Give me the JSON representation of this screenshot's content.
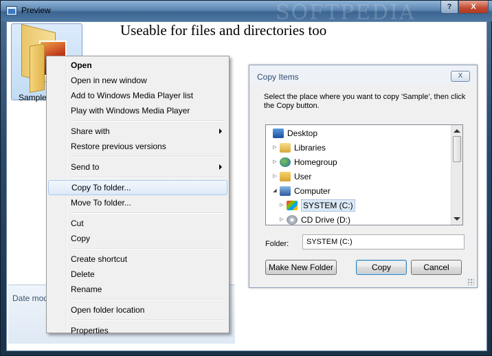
{
  "window": {
    "title": "Preview",
    "watermark": "SOFTPEDIA",
    "help_label": "?",
    "close_label": "X"
  },
  "headline": "Useable for files and directories too",
  "explorer": {
    "folder_name": "Sample",
    "status_text": "Date mod"
  },
  "context_menu": {
    "items": [
      {
        "label": "Open",
        "bold": true
      },
      {
        "label": "Open in new window"
      },
      {
        "label": "Add to Windows Media Player list"
      },
      {
        "label": "Play with Windows Media Player"
      },
      {
        "label": "Share with",
        "submenu": true
      },
      {
        "label": "Restore previous versions"
      },
      {
        "label": "Send to",
        "submenu": true
      },
      {
        "label": "Copy To folder...",
        "highlighted": true
      },
      {
        "label": "Move To folder..."
      },
      {
        "label": "Cut"
      },
      {
        "label": "Copy"
      },
      {
        "label": "Create shortcut"
      },
      {
        "label": "Delete"
      },
      {
        "label": "Rename"
      },
      {
        "label": "Open folder location"
      },
      {
        "label": "Properties"
      }
    ]
  },
  "dialog": {
    "title": "Copy Items",
    "close_label": "X",
    "description": "Select the place where you want to copy 'Sample', then click the Copy button.",
    "tree": [
      {
        "label": "Desktop",
        "icon": "desktop-icon"
      },
      {
        "label": "Libraries",
        "icon": "libraries-icon",
        "twisty": "collapsed"
      },
      {
        "label": "Homegroup",
        "icon": "homegroup-icon",
        "twisty": "collapsed"
      },
      {
        "label": "User",
        "icon": "user-folder-icon",
        "twisty": "collapsed"
      },
      {
        "label": "Computer",
        "icon": "computer-icon",
        "twisty": "expanded"
      },
      {
        "label": "SYSTEM (C:)",
        "icon": "system-drive-icon",
        "twisty": "collapsed",
        "selected": true
      },
      {
        "label": "CD Drive (D:)",
        "icon": "cd-drive-icon",
        "twisty": "collapsed"
      }
    ],
    "folder_label": "Folder:",
    "folder_value": "SYSTEM (C:)",
    "buttons": {
      "make_new_folder": "Make New Folder",
      "copy": "Copy",
      "cancel": "Cancel"
    }
  }
}
